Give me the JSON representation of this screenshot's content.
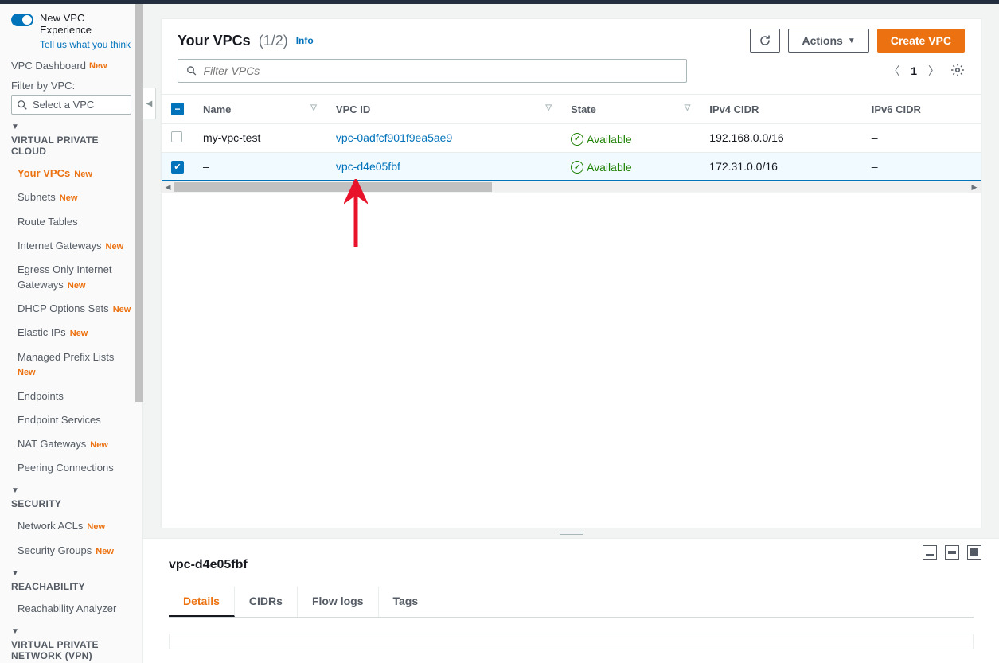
{
  "toggle": {
    "label": "New VPC Experience",
    "sublink": "Tell us what you think"
  },
  "sidebar": {
    "dashboard": {
      "label": "VPC Dashboard",
      "new": "New"
    },
    "filter_label": "Filter by VPC:",
    "filter_placeholder": "Select a VPC",
    "sections": [
      {
        "title": "VIRTUAL PRIVATE CLOUD",
        "items": [
          {
            "label": "Your VPCs",
            "new": "New",
            "active": true
          },
          {
            "label": "Subnets",
            "new": "New"
          },
          {
            "label": "Route Tables"
          },
          {
            "label": "Internet Gateways",
            "new": "New"
          },
          {
            "label": "Egress Only Internet Gateways",
            "new": "New"
          },
          {
            "label": "DHCP Options Sets",
            "new": "New"
          },
          {
            "label": "Elastic IPs",
            "new": "New"
          },
          {
            "label": "Managed Prefix Lists",
            "new": "New"
          },
          {
            "label": "Endpoints"
          },
          {
            "label": "Endpoint Services"
          },
          {
            "label": "NAT Gateways",
            "new": "New"
          },
          {
            "label": "Peering Connections"
          }
        ]
      },
      {
        "title": "SECURITY",
        "items": [
          {
            "label": "Network ACLs",
            "new": "New"
          },
          {
            "label": "Security Groups",
            "new": "New"
          }
        ]
      },
      {
        "title": "REACHABILITY",
        "items": [
          {
            "label": "Reachability Analyzer"
          }
        ]
      },
      {
        "title": "VIRTUAL PRIVATE NETWORK (VPN)",
        "items": []
      }
    ]
  },
  "header": {
    "title": "Your VPCs",
    "count": "(1/2)",
    "info": "Info",
    "actions_label": "Actions",
    "create_label": "Create VPC"
  },
  "search": {
    "placeholder": "Filter VPCs"
  },
  "pager": {
    "page": "1"
  },
  "columns": [
    "",
    "Name",
    "VPC ID",
    "State",
    "IPv4 CIDR",
    "IPv6 CIDR"
  ],
  "rows": [
    {
      "selected": false,
      "name": "my-vpc-test",
      "vpc_id": "vpc-0adfcf901f9ea5ae9",
      "state": "Available",
      "ipv4": "192.168.0.0/16",
      "ipv6": "–"
    },
    {
      "selected": true,
      "name": "–",
      "vpc_id": "vpc-d4e05fbf",
      "state": "Available",
      "ipv4": "172.31.0.0/16",
      "ipv6": "–"
    }
  ],
  "detail": {
    "title": "vpc-d4e05fbf",
    "tabs": [
      "Details",
      "CIDRs",
      "Flow logs",
      "Tags"
    ],
    "active_tab": 0
  }
}
